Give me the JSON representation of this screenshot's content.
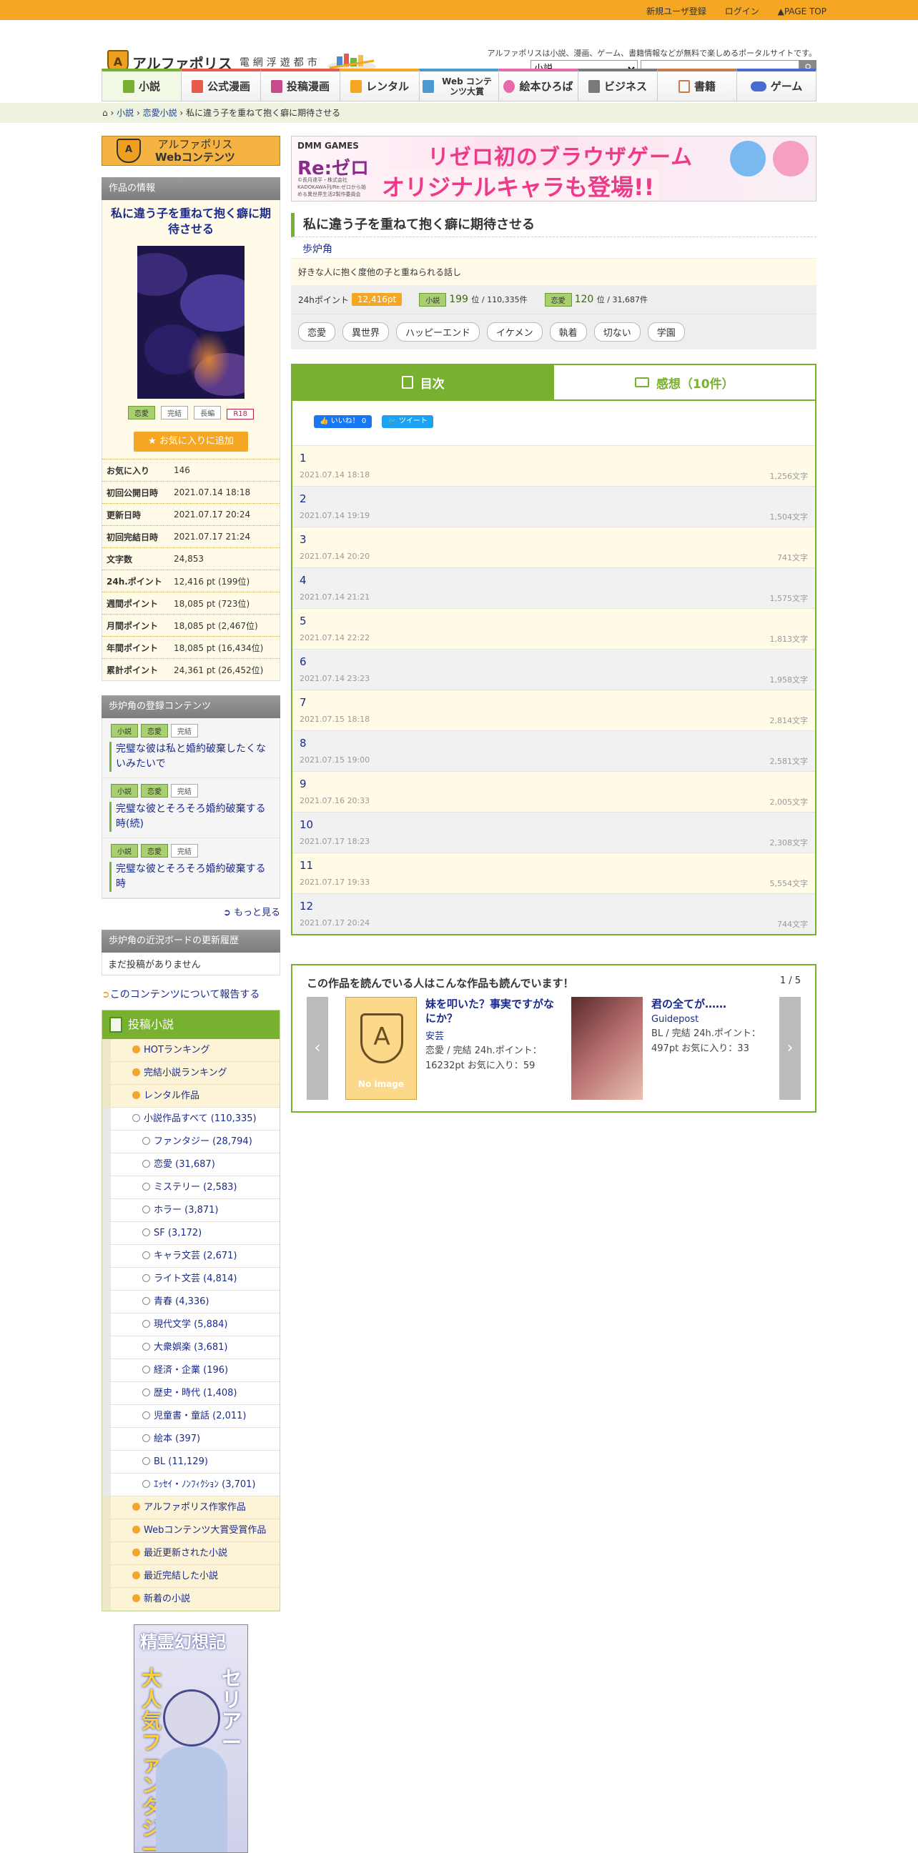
{
  "topbar": {
    "register": "新規ユーザ登録",
    "login": "ログイン",
    "pagetop": "PAGE TOP"
  },
  "header": {
    "logo_sub": "アルファポリス",
    "tagline": "電網浮遊都市",
    "description": "アルファポリスは小説、漫画、ゲーム、書籍情報などが無料で楽しめるポータルサイトです。",
    "search_select": "小説"
  },
  "nav": [
    "小説",
    "公式漫画",
    "投稿漫画",
    "レンタル",
    "Web コンテンツ大賞",
    "絵本ひろば",
    "ビジネス",
    "書籍",
    "ゲーム"
  ],
  "breadcrumb": {
    "sep": "›",
    "items": [
      "小説",
      "恋愛小説",
      "私に違う子を重ねて抱く癖に期待させる"
    ]
  },
  "sidebar": {
    "web_badge_line1": "アルファポリス",
    "web_badge_line2": "Webコンテンツ",
    "info_header": "作品の情報",
    "work_title": "私に違う子を重ねて抱く癖に期待させる",
    "badges": [
      "恋愛",
      "完結",
      "長編",
      "R18"
    ],
    "fav_button": "お気に入りに追加",
    "stats": [
      {
        "k": "お気に入り",
        "v": "146"
      },
      {
        "k": "初回公開日時",
        "v": "2021.07.14 18:18"
      },
      {
        "k": "更新日時",
        "v": "2021.07.17 20:24"
      },
      {
        "k": "初回完結日時",
        "v": "2021.07.17 21:24"
      },
      {
        "k": "文字数",
        "v": "24,853"
      },
      {
        "k": "24h.ポイント",
        "v": "12,416 pt (199位)"
      },
      {
        "k": "週間ポイント",
        "v": "18,085 pt (723位)"
      },
      {
        "k": "月間ポイント",
        "v": "18,085 pt (2,467位)"
      },
      {
        "k": "年間ポイント",
        "v": "18,085 pt (16,434位)"
      },
      {
        "k": "累計ポイント",
        "v": "24,361 pt (26,452位)"
      }
    ],
    "reg_header": "歩炉角の登録コンテンツ",
    "reg_items": [
      {
        "tags": [
          "小説",
          "恋愛",
          "完結"
        ],
        "title": "完璧な彼は私と婚約破棄したくないみたいで"
      },
      {
        "tags": [
          "小説",
          "恋愛",
          "完結"
        ],
        "title": "完璧な彼とそろそろ婚約破棄する時(続)"
      },
      {
        "tags": [
          "小説",
          "恋愛",
          "完結"
        ],
        "title": "完璧な彼とそろそろ婚約破棄する時"
      }
    ],
    "more": "もっと見る",
    "board_header": "歩炉角の近況ボードの更新履歴",
    "board_empty": "まだ投稿がありません",
    "report": "このコンテンツについて報告する",
    "cat_header": "投稿小説",
    "cat_items": [
      {
        "label": "HOTランキング",
        "level": 1
      },
      {
        "label": "完結小説ランキング",
        "level": 1
      },
      {
        "label": "レンタル作品",
        "level": 1
      },
      {
        "label": "小説作品すべて (110,335)",
        "level": 2
      },
      {
        "label": "ファンタジー (28,794)",
        "level": 3
      },
      {
        "label": "恋愛 (31,687)",
        "level": 3
      },
      {
        "label": "ミステリー (2,583)",
        "level": 3
      },
      {
        "label": "ホラー (3,871)",
        "level": 3
      },
      {
        "label": "SF (3,172)",
        "level": 3
      },
      {
        "label": "キャラ文芸 (2,671)",
        "level": 3
      },
      {
        "label": "ライト文芸 (4,814)",
        "level": 3
      },
      {
        "label": "青春 (4,336)",
        "level": 3
      },
      {
        "label": "現代文学 (5,884)",
        "level": 3
      },
      {
        "label": "大衆娯楽 (3,681)",
        "level": 3
      },
      {
        "label": "経済・企業 (196)",
        "level": 3
      },
      {
        "label": "歴史・時代 (1,408)",
        "level": 3
      },
      {
        "label": "児童書・童話 (2,011)",
        "level": 3
      },
      {
        "label": "絵本 (397)",
        "level": 3
      },
      {
        "label": "BL (11,129)",
        "level": 3
      },
      {
        "label": "ｴｯｾｲ・ﾉﾝﾌｨｸｼｮﾝ (3,701)",
        "level": 3
      },
      {
        "label": "アルファポリス作家作品",
        "level": 1
      },
      {
        "label": "Webコンテンツ大賞受賞作品",
        "level": 1
      },
      {
        "label": "最近更新された小説",
        "level": 1
      },
      {
        "label": "最近完結した小説",
        "level": 1
      },
      {
        "label": "新着の小説",
        "level": 1
      }
    ],
    "side_banner_line1": "精霊幻想記",
    "side_banner_line2": "大人気ファンタジー",
    "side_banner_line3": "セリアー"
  },
  "main": {
    "banner": {
      "brand": "DMM GAMES",
      "logo": "Re:ゼロ",
      "line1": "リゼロ初のブラウザゲーム",
      "line2": "オリジナルキャラも登場!!",
      "credit": "©長月達平・株式会社KADOKAWA刊/Re:ゼロから始める異世界生活2製作委員会"
    },
    "title": "私に違う子を重ねて抱く癖に期待させる",
    "author": "歩炉角",
    "description": "好きな人に抱く度他の子と重ねられる話し",
    "points_label": "24hポイント",
    "points_value": "12,416pt",
    "rank1_tag": "小説",
    "rank1_pos": "199",
    "rank1_total": "位 / 110,335件",
    "rank2_tag": "恋愛",
    "rank2_pos": "120",
    "rank2_total": "位 / 31,687件",
    "tags": [
      "恋愛",
      "異世界",
      "ハッピーエンド",
      "イケメン",
      "執着",
      "切ない",
      "学園"
    ],
    "tab_toc": "目次",
    "tab_comments": "感想（10件）",
    "like_button": "いいね！ 0",
    "tweet_button": "ツイート",
    "episodes": [
      {
        "n": "1",
        "date": "2021.07.14 18:18",
        "chars": "1,256文字"
      },
      {
        "n": "2",
        "date": "2021.07.14 19:19",
        "chars": "1,504文字"
      },
      {
        "n": "3",
        "date": "2021.07.14 20:20",
        "chars": "741文字"
      },
      {
        "n": "4",
        "date": "2021.07.14 21:21",
        "chars": "1,575文字"
      },
      {
        "n": "5",
        "date": "2021.07.14 22:22",
        "chars": "1,813文字"
      },
      {
        "n": "6",
        "date": "2021.07.14 23:23",
        "chars": "1,958文字"
      },
      {
        "n": "7",
        "date": "2021.07.15 18:18",
        "chars": "2,814文字"
      },
      {
        "n": "8",
        "date": "2021.07.15 19:00",
        "chars": "2,581文字"
      },
      {
        "n": "9",
        "date": "2021.07.16 20:33",
        "chars": "2,005文字"
      },
      {
        "n": "10",
        "date": "2021.07.17 18:23",
        "chars": "2,308文字"
      },
      {
        "n": "11",
        "date": "2021.07.17 19:33",
        "chars": "5,554文字"
      },
      {
        "n": "12",
        "date": "2021.07.17 20:24",
        "chars": "744文字"
      }
    ],
    "reco_header": "この作品を読んでいる人はこんな作品も読んでいます！",
    "reco_page": "1 / 5",
    "reco": [
      {
        "title": "妹を叩いた？事実ですがなにか？",
        "author": "安芸",
        "meta": "恋愛 / 完結 24h.ポイント：16232pt お気に入り：59",
        "noimage": "No image"
      },
      {
        "title": "君の全てが……",
        "author": "Guidepost",
        "meta": "BL / 完結 24h.ポイント：497pt お気に入り：33"
      }
    ]
  }
}
